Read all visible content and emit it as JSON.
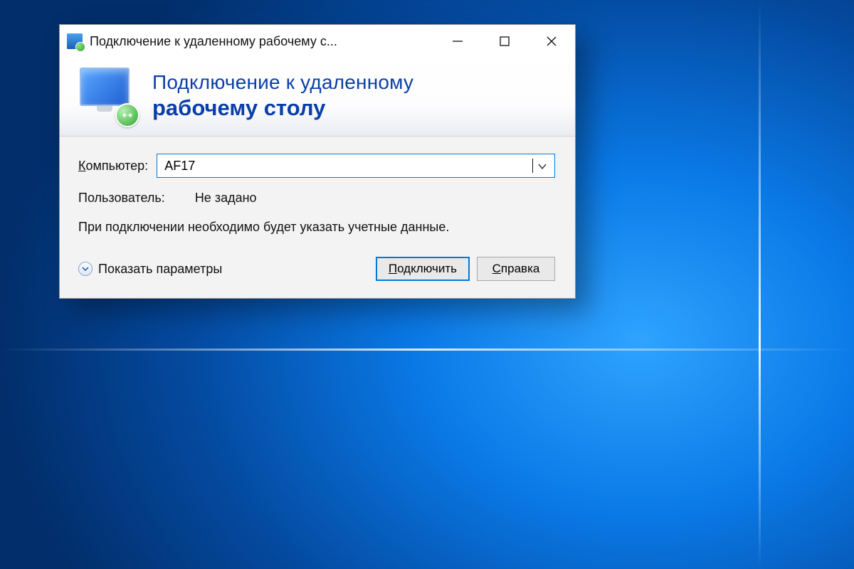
{
  "window": {
    "title": "Подключение к удаленному рабочему с..."
  },
  "header": {
    "line1": "Подключение к удаленному",
    "line2": "рабочему столу"
  },
  "form": {
    "computer_label": "омпьютер:",
    "computer_label_hotkey": "К",
    "computer_value": "AF17",
    "user_label": "Пользователь:",
    "user_value": "Не задано",
    "credentials_hint": "При подключении необходимо будет указать учетные данные."
  },
  "footer": {
    "show_options": "Показать параметры",
    "connect_hotkey": "П",
    "connect_rest": "одключить",
    "help_hotkey": "С",
    "help_rest": "правка"
  }
}
